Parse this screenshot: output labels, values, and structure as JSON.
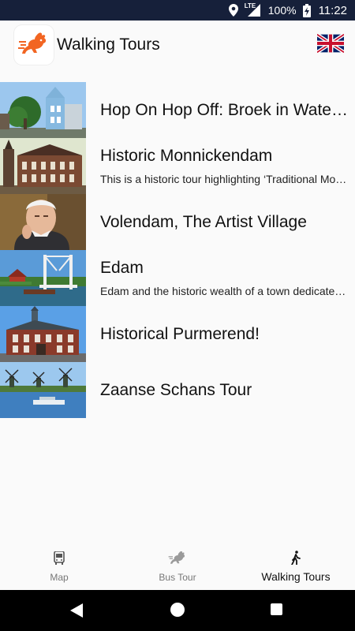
{
  "status_bar": {
    "network_label": "LTE",
    "battery": "100%",
    "time": "11:22"
  },
  "app_bar": {
    "title": "Walking Tours"
  },
  "tours": [
    {
      "title": "Hop On Hop Off: Broek in Waterland",
      "description": ""
    },
    {
      "title": "Historic Monnickendam",
      "description": "This is a historic tour highlighting ‘Traditional Monnickendam’"
    },
    {
      "title": "Volendam, The Artist Village",
      "description": ""
    },
    {
      "title": "Edam",
      "description": "Edam and the historic wealth of a town dedicated to cheese"
    },
    {
      "title": "Historical Purmerend!",
      "description": ""
    },
    {
      "title": "Zaanse Schans Tour",
      "description": ""
    }
  ],
  "bottom_nav": {
    "items": [
      {
        "label": "Map"
      },
      {
        "label": "Bus Tour"
      },
      {
        "label": "Walking Tours"
      }
    ],
    "active": "Walking Tours"
  },
  "colors": {
    "status_bar": "#16203a",
    "logo_accent": "#f26522",
    "background": "#fafafa"
  }
}
